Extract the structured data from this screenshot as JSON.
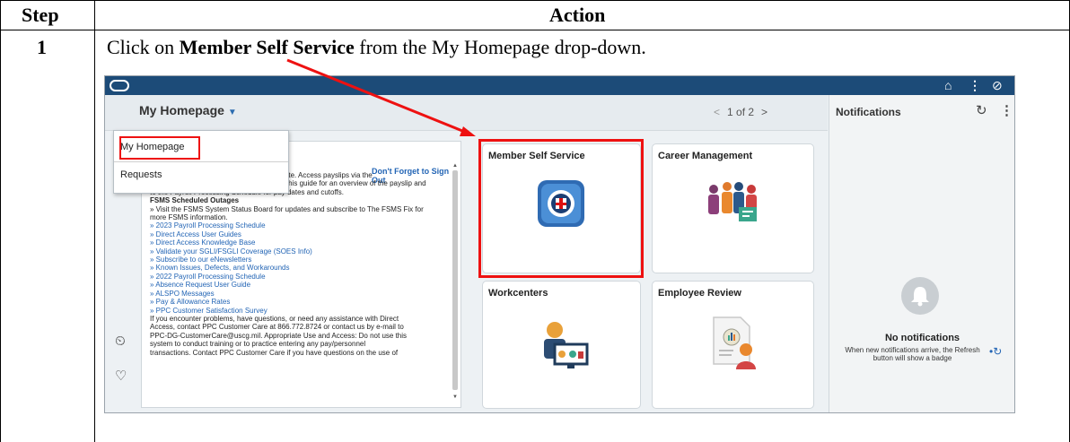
{
  "table": {
    "header_step": "Step",
    "header_action": "Action",
    "step_number": "1",
    "instruction_pre": "Click on ",
    "instruction_bold": "Member Self Service",
    "instruction_post": " from the My Homepage drop-down."
  },
  "app": {
    "topbar_icons": [
      "home-icon",
      "kebab-menu-icon",
      "compass-icon"
    ],
    "homepage_label": "My Homepage",
    "pager_text": "1 of 2",
    "dropdown_items": [
      "My Homepage",
      "Requests"
    ],
    "pane": {
      "sign_out_link": "Don't Forget to Sign Out",
      "lines": [
        "r to each pay date.  Access payslips via the",
        "Self Service - View - Mail/Payslip. Refer to this guide for an overview of the payslip and",
        "to the Payroll Processing Schedule for pay dates and cutoffs.",
        "FSMS Scheduled Outages",
        "» Visit the FSMS System Status Board for updates and subscribe to The FSMS Fix for",
        "more FSMS information.",
        "» 2023 Payroll Processing Schedule",
        "» Direct Access User Guides",
        "» Direct Access Knowledge Base",
        "» Validate your SGLI/FSGLI Coverage (SOES Info)",
        "» Subscribe to our eNewsletters",
        "» Known Issues, Defects, and Workarounds",
        "» 2022 Payroll Processing Schedule",
        "» Absence Request User Guide",
        "» ALSPO Messages",
        "» Pay & Allowance Rates",
        "» PPC Customer Satisfaction Survey",
        "If you encounter problems, have questions, or need any assistance with Direct",
        "Access, contact PPC Customer Care at 866.772.8724 or contact us by e-mail to",
        "PPC-DG-CustomerCare@uscg.mil. Appropriate Use and Access: Do not use this",
        "system to conduct training or to practice entering any pay/personnel",
        "transactions. Contact PPC Customer Care if you have questions on the use of"
      ]
    },
    "tiles": [
      {
        "title": "Member Self Service",
        "icon": "coast-guard-seal-icon"
      },
      {
        "title": "Career Management",
        "icon": "people-group-icon"
      },
      {
        "title": "Workcenters",
        "icon": "workcenter-icon"
      },
      {
        "title": "Employee Review",
        "icon": "employee-review-icon"
      }
    ],
    "notifications": {
      "title": "Notifications",
      "empty_title": "No notifications",
      "empty_text": "When new notifications arrive, the Refresh button will show a badge"
    },
    "colors": {
      "topbar": "#1c4b78",
      "highlight": "#e11111",
      "link": "#2365b5"
    }
  }
}
